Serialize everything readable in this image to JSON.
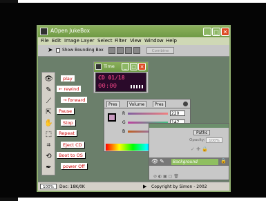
{
  "window": {
    "title": "AOpen JukeBox",
    "menus": [
      "File",
      "Edit",
      "Image",
      "Layer",
      "Select",
      "Filter",
      "View",
      "Window",
      "Help"
    ],
    "toolbar": {
      "bounding_box_label": "Show Bounding Box",
      "combine_label": "Combine"
    }
  },
  "buttons": {
    "play": "play",
    "rewind": "← rewind",
    "forward": "→ forward",
    "pause": "Pause",
    "stop": "Stop",
    "repeat": "Repeat",
    "eject": "Eject CD",
    "boot": "Boot to OS",
    "power": "power Off"
  },
  "timer": {
    "title": "Time",
    "track": "CD 01/18",
    "time": "00:00"
  },
  "mixer": {
    "tabs": [
      "Pres",
      "Volume",
      "Pres"
    ],
    "channels": [
      {
        "label": "R",
        "value": "220"
      },
      {
        "label": "G",
        "value": "147"
      },
      {
        "label": "B",
        "value": "192"
      }
    ],
    "colors": {
      "swatch": "#c99ac0",
      "r": "#d06060",
      "g": "#60c060",
      "b": "#6060d0"
    }
  },
  "layers": {
    "tabs": [
      "Paths"
    ],
    "opacity_label": "Opacity:",
    "opacity_value": "100%",
    "layer_name": "Background"
  },
  "status": {
    "zoom": "100%",
    "doc": "Doc: 18K/0K",
    "copyright": "Copyright by Simon - 2002"
  }
}
